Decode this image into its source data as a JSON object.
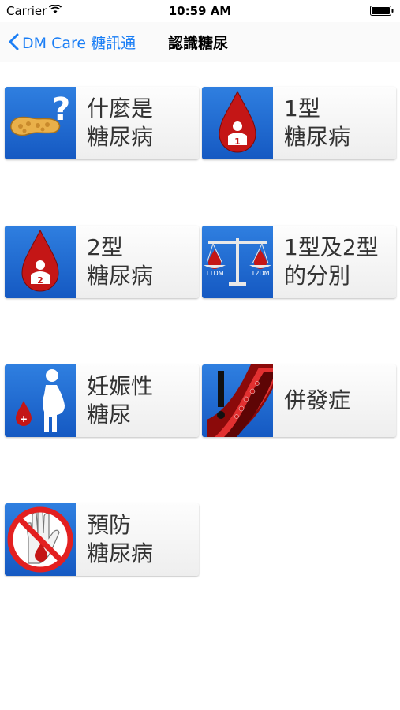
{
  "status_bar": {
    "carrier": "Carrier",
    "time": "10:59 AM"
  },
  "nav": {
    "back_label": "DM Care 糖訊通",
    "title": "認識糖尿"
  },
  "tiles": [
    {
      "line1": "什麼是",
      "line2": "糖尿病",
      "icon": "pancreas-question-icon"
    },
    {
      "line1": "1型",
      "line2": "糖尿病",
      "icon": "type1-blood-drop-icon",
      "badge": "1"
    },
    {
      "line1": "2型",
      "line2": "糖尿病",
      "icon": "type2-blood-drop-icon",
      "badge": "2"
    },
    {
      "line1": "1型及2型",
      "line2": "的分別",
      "icon": "balance-scale-icon",
      "left_label": "T1DM",
      "right_label": "T2DM"
    },
    {
      "line1": "妊娠性",
      "line2": "糖尿",
      "icon": "pregnancy-icon"
    },
    {
      "line1": "",
      "line2": "併發症",
      "icon": "blood-vessel-warning-icon"
    },
    {
      "line1": "預防",
      "line2": "糖尿病",
      "icon": "stop-hand-icon"
    }
  ],
  "colors": {
    "accent": "#1a7ef5",
    "icon_bg": "#1f66d1",
    "blood_red": "#c41616"
  }
}
